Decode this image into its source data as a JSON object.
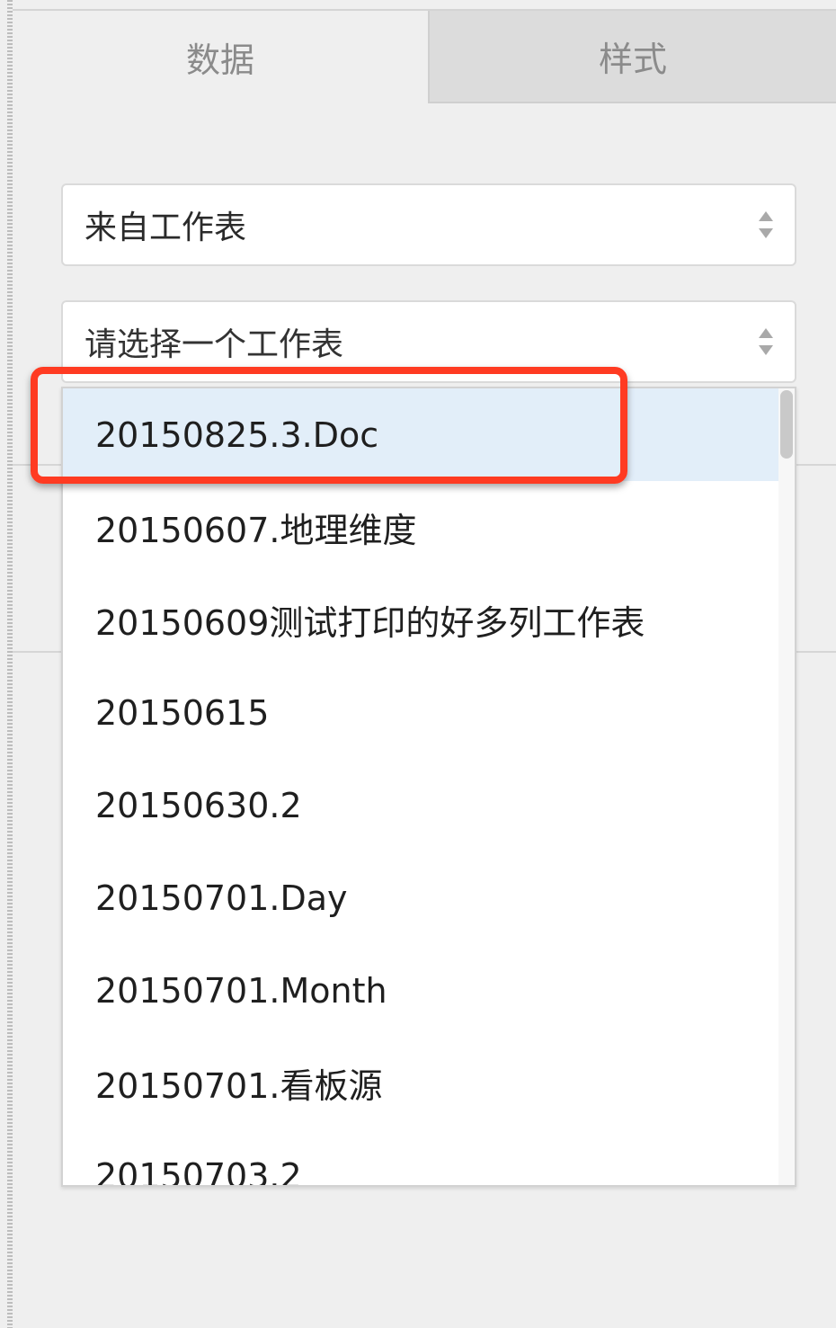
{
  "tabs": [
    {
      "label": "数据",
      "active": true
    },
    {
      "label": "样式",
      "active": false
    }
  ],
  "source_select": {
    "value": "来自工作表"
  },
  "sheet_select": {
    "placeholder": "请选择一个工作表"
  },
  "dropdown": {
    "items": [
      {
        "label": "20150825.3.Doc",
        "selected": true
      },
      {
        "label": "20150607.地理维度",
        "selected": false
      },
      {
        "label": "20150609测试打印的好多列工作表",
        "selected": false
      },
      {
        "label": "20150615",
        "selected": false
      },
      {
        "label": "20150630.2",
        "selected": false
      },
      {
        "label": "20150701.Day",
        "selected": false
      },
      {
        "label": "20150701.Month",
        "selected": false
      },
      {
        "label": "20150701.看板源",
        "selected": false
      },
      {
        "label": "20150703.2",
        "selected": false
      }
    ]
  },
  "colors": {
    "highlight": "#ff3b22",
    "selected_row": "#e2eef9",
    "inactive_tab": "#dcdcdc"
  },
  "icons": {
    "select_arrow": "up-down-spinner-icon"
  }
}
